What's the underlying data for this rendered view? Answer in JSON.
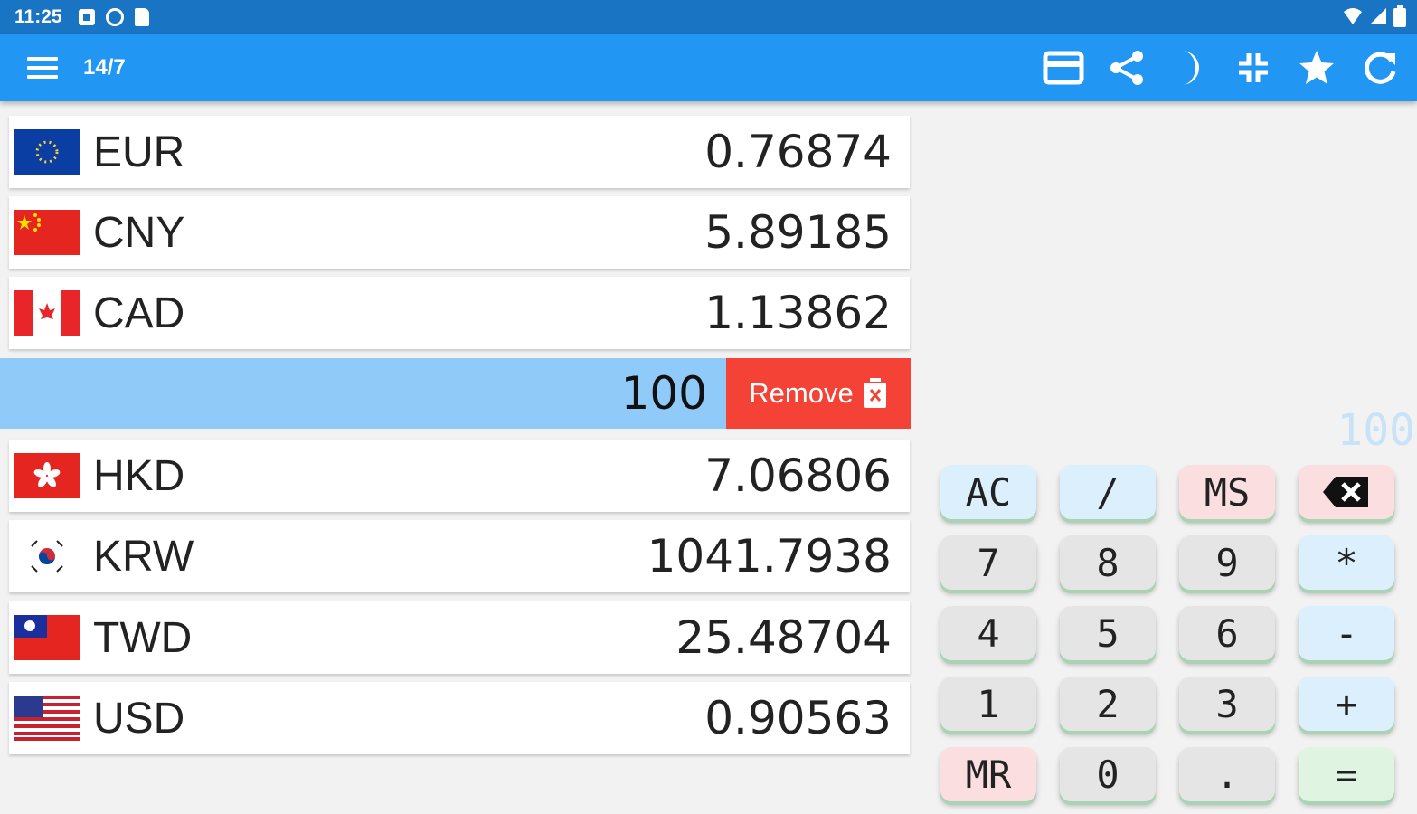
{
  "status_bar": {
    "time": "11:25"
  },
  "app_bar": {
    "title": "14/7"
  },
  "currencies": [
    {
      "code": "EUR",
      "value": "0.76874"
    },
    {
      "code": "CNY",
      "value": "5.89185"
    },
    {
      "code": "CAD",
      "value": "1.13862"
    },
    {
      "code": "HKD",
      "value": "7.06806"
    },
    {
      "code": "KRW",
      "value": "1041.7938"
    },
    {
      "code": "TWD",
      "value": "25.48704"
    },
    {
      "code": "USD",
      "value": "0.90563"
    }
  ],
  "active_row": {
    "value": "100",
    "remove_label": "Remove"
  },
  "calculator": {
    "display": "100",
    "keys": [
      "AC",
      "/",
      "MS",
      "",
      "7",
      "8",
      "9",
      "*",
      "4",
      "5",
      "6",
      "-",
      "1",
      "2",
      "3",
      "+",
      "MR",
      "0",
      ".",
      "="
    ]
  },
  "colors": {
    "appbar": "#2196f3",
    "statusbar": "#1a74c4",
    "remove": "#f44336",
    "active_row": "#90caf9"
  }
}
